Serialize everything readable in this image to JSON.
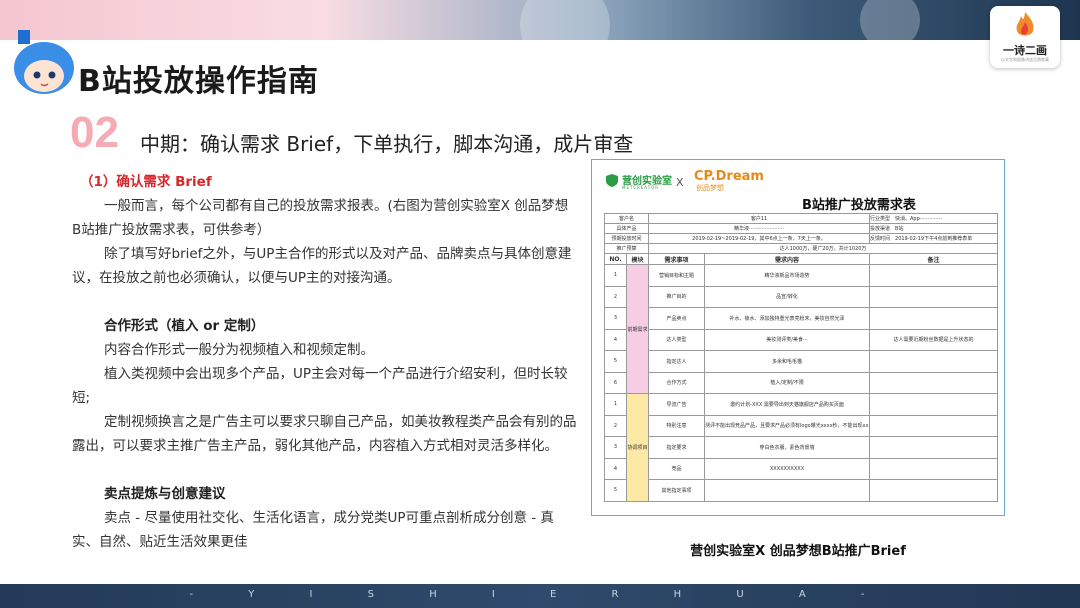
{
  "header": {
    "title": "B站投放操作指南",
    "logo_text": "一诗二画",
    "logo_sub": "以文字和图像讲述品牌故事"
  },
  "section": {
    "number": "02",
    "title": "中期：确认需求 Brief，下单执行，脚本沟通，成片审查"
  },
  "content": {
    "h1": "（1）确认需求 Brief",
    "p1": "一般而言，每个公司都有自己的投放需求报表。(右图为营创实验室X 创品梦想B站推广投放需求表，可供参考）",
    "p2": "除了填写好brief之外，与UP主合作的形式以及对产品、品牌卖点与具体创意建议，在投放之前也必须确认，以便与UP主的对接沟通。",
    "h2": "合作形式（植入 or 定制）",
    "p3": "内容合作形式一般分为视频植入和视频定制。",
    "p4": "植入类视频中会出现多个产品，UP主会对每一个产品进行介绍安利，但时长较短;",
    "p5": "定制视频换言之是广告主可以要求只聊自己产品，如美妆教程类产品会有别的品露出，可以要求主推广告主产品，弱化其他产品，内容植入方式相对灵活多样化。",
    "h3": "卖点提炼与创意建议",
    "p6": "卖点 - 尽量使用社交化、生活化语言，成分党类UP可重点剖析成分创意 - 真实、自然、贴近生活效果更佳"
  },
  "figure": {
    "caption": "营创实验室X 创品梦想B站推广Brief",
    "brand1": "营创实验室",
    "brand1_sub": "METCREATOR",
    "x": "X",
    "brand2": "CP.Dream",
    "brand2_sub": "创品梦想",
    "form_title": "B站推广投放需求表",
    "info": [
      {
        "label_a": "客户名",
        "value_a": "客户11",
        "label_b": "行业类型",
        "value_b": "快消、App··············"
      },
      {
        "label_a": "具体产品",
        "value_a": "精华液······················",
        "label_b": "投放渠道",
        "value_b": "B站"
      },
      {
        "label_a": "预期投放时间",
        "value_a": "2019-02-19~2019-02-19，其中6点上一条，7天上一条。",
        "label_b": "反馈时间",
        "value_b": "2019-02-19下午4点前到推荐表单"
      }
    ],
    "budget_label": "推广预算",
    "budget_value": "达人1000万，硬广20万，共计1020万",
    "headers": {
      "no": "NO.",
      "module": "模块",
      "item": "需求事项",
      "content": "需求内容",
      "note": "备注"
    },
    "module1": "前期需求",
    "module2": "协调项目",
    "rows": [
      {
        "no": "1",
        "item": "营销目标和主题",
        "content": "精华液新品市场造势",
        "note": ""
      },
      {
        "no": "2",
        "item": "推广目的",
        "content": "品宣/转化",
        "note": ""
      },
      {
        "no": "3",
        "item": "产品卖点",
        "content": "补水、锁水、添加独特重光表亮粉末，美妆自然光泽",
        "note": ""
      },
      {
        "no": "4",
        "item": "达人类型",
        "content": "美妆测评类/美食···",
        "note": "达人需要近期粉丝数据是上升状态的"
      },
      {
        "no": "5",
        "item": "指定达人",
        "content": "多余和毛毛猫",
        "note": ""
      },
      {
        "no": "6",
        "item": "合作方式",
        "content": "植入/定制/不限",
        "note": ""
      },
      {
        "no": "1",
        "item": "导流广告",
        "content": "邀约计划-XXX 需要导出到天猫旗舰店产品购买页面",
        "note": ""
      },
      {
        "no": "2",
        "item": "特别注意",
        "content": "测评不能出现竞品产品，且要求产品必须有logo曝光xxxx秒，不能出现xxxx词。",
        "note": ""
      },
      {
        "no": "3",
        "item": "指定要求",
        "content": "穿白色衣服，素色背景墙",
        "note": ""
      },
      {
        "no": "4",
        "item": "竞品",
        "content": "XXXXXXXXXX",
        "note": ""
      },
      {
        "no": "5",
        "item": "其他指定事项",
        "content": "",
        "note": ""
      }
    ]
  },
  "footer": {
    "text": "- Y I S H I E R H U A -"
  },
  "colors": {
    "accent_red": "#d9262b",
    "section_pink": "#f5aab4",
    "figure_border": "#6aa8d6"
  }
}
